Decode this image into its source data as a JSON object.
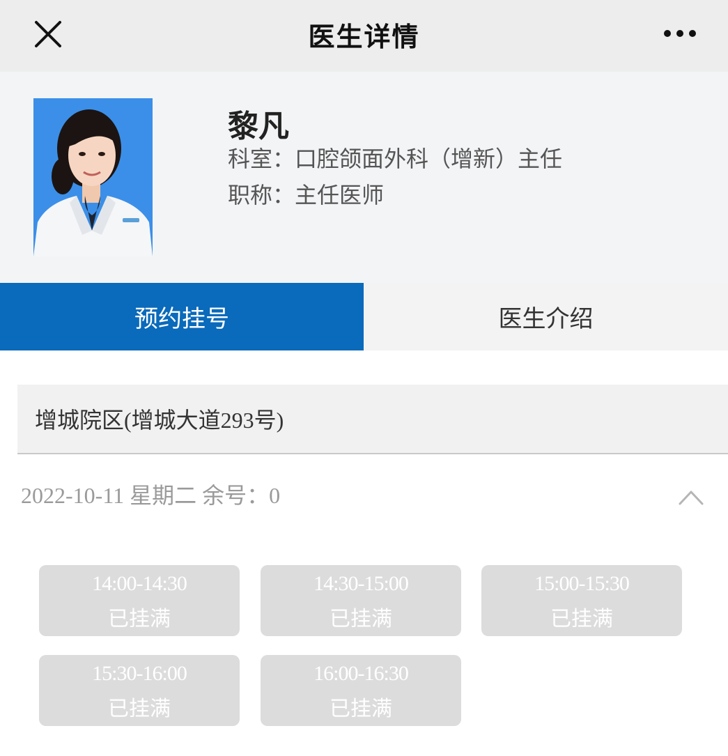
{
  "nav": {
    "title": "医生详情",
    "close_icon": "close-icon",
    "more_icon": "more-icon"
  },
  "doctor": {
    "name": "黎凡",
    "department": "科室：口腔颌面外科（增新）主任",
    "title": "职称：主任医师",
    "photo_bg": "#3b8fe8"
  },
  "tabs": [
    {
      "label": "预约挂号",
      "active": true
    },
    {
      "label": "医生介绍",
      "active": false
    }
  ],
  "campus": {
    "label": "增城院区(增城大道293号)"
  },
  "schedule": {
    "date_line": "2022-10-11 星期二 余号：0",
    "collapse_icon": "chevron-up-icon",
    "slots": [
      {
        "time": "14:00-14:30",
        "status": "已挂满"
      },
      {
        "time": "14:30-15:00",
        "status": "已挂满"
      },
      {
        "time": "15:00-15:30",
        "status": "已挂满"
      },
      {
        "time": "15:30-16:00",
        "status": "已挂满"
      },
      {
        "time": "16:00-16:30",
        "status": "已挂满"
      }
    ]
  },
  "colors": {
    "accent": "#0a6abb",
    "slot_disabled": "#dcdcdc"
  }
}
